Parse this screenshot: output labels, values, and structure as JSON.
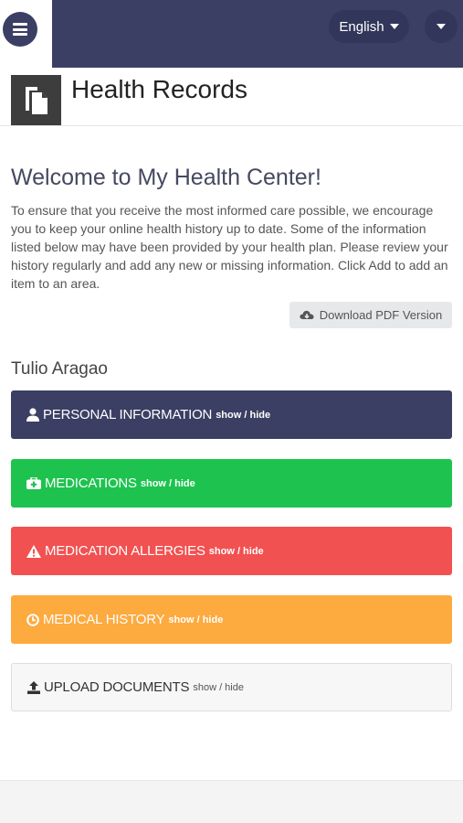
{
  "nav": {
    "language": "English",
    "menu_icon": "hamburger-menu-icon",
    "user_icon": "chevron-down-icon"
  },
  "header": {
    "title": "Health Records",
    "icon": "document-icon"
  },
  "welcome": {
    "title": "Welcome to My Health Center!",
    "text": "To ensure that you receive the most informed care possible, we encourage you to keep your online health history up to date. Some of the information listed below may have been provided by your health plan. Please review your history regularly and add any new or missing information. Click Add to add an item to an area."
  },
  "pdf_button": "Download PDF Version",
  "patient_name": "Tulio Aragao",
  "sections": [
    {
      "title": "PERSONAL INFORMATION",
      "toggle": "show / hide",
      "icon": "user-icon",
      "color": "#3b3f63"
    },
    {
      "title": "MEDICATIONS",
      "toggle": "show / hide",
      "icon": "medkit-icon",
      "color": "#1dc34e"
    },
    {
      "title": "MEDICATION ALLERGIES",
      "toggle": "show / hide",
      "icon": "warning-icon",
      "color": "#f25151"
    },
    {
      "title": "MEDICAL HISTORY",
      "toggle": "show / hide",
      "icon": "clock-icon",
      "color": "#fdaa3f"
    },
    {
      "title": "UPLOAD DOCUMENTS",
      "toggle": "show / hide",
      "icon": "upload-icon",
      "color": "#f7f7f7"
    }
  ]
}
